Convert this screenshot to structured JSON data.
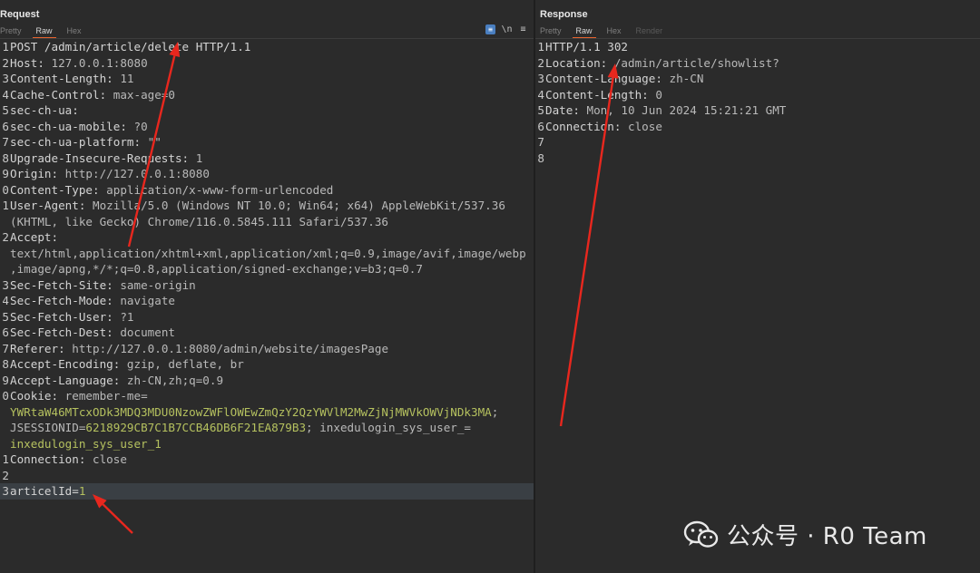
{
  "request": {
    "title": "Request",
    "tabs": [
      "Pretty",
      "Raw",
      "Hex"
    ],
    "active_tab": "Raw",
    "toolbar": {
      "wrap_icon": "wrap-icon",
      "newline_label": "\\n",
      "menu_icon": "menu-icon"
    },
    "lines": [
      {
        "n": "1",
        "parts": [
          {
            "t": "POST /admin/article/delete HTTP/1.1",
            "c": "k"
          }
        ]
      },
      {
        "n": "2",
        "parts": [
          {
            "t": "Host: ",
            "c": "k"
          },
          {
            "t": "127.0.0.1:8080",
            "c": "v"
          }
        ]
      },
      {
        "n": "3",
        "parts": [
          {
            "t": "Content-Length: ",
            "c": "k"
          },
          {
            "t": "11",
            "c": "v"
          }
        ]
      },
      {
        "n": "4",
        "parts": [
          {
            "t": "Cache-Control: ",
            "c": "k"
          },
          {
            "t": "max-age=0",
            "c": "v"
          }
        ]
      },
      {
        "n": "5",
        "parts": [
          {
            "t": "sec-ch-ua:",
            "c": "k"
          }
        ]
      },
      {
        "n": "6",
        "parts": [
          {
            "t": "sec-ch-ua-mobile: ",
            "c": "k"
          },
          {
            "t": "?0",
            "c": "v"
          }
        ]
      },
      {
        "n": "7",
        "parts": [
          {
            "t": "sec-ch-ua-platform: ",
            "c": "k"
          },
          {
            "t": "\"\"",
            "c": "v"
          }
        ]
      },
      {
        "n": "8",
        "parts": [
          {
            "t": "Upgrade-Insecure-Requests: ",
            "c": "k"
          },
          {
            "t": "1",
            "c": "v"
          }
        ]
      },
      {
        "n": "9",
        "parts": [
          {
            "t": "Origin: ",
            "c": "k"
          },
          {
            "t": "http://127.0.0.1:8080",
            "c": "v"
          }
        ]
      },
      {
        "n": "0",
        "parts": [
          {
            "t": "Content-Type: ",
            "c": "k"
          },
          {
            "t": "application/x-www-form-urlencoded",
            "c": "v"
          }
        ]
      },
      {
        "n": "1",
        "parts": [
          {
            "t": "User-Agent: ",
            "c": "k"
          },
          {
            "t": "Mozilla/5.0 (Windows NT 10.0; Win64; x64) AppleWebKit/537.36",
            "c": "v"
          }
        ]
      },
      {
        "n": "",
        "parts": [
          {
            "t": "(KHTML, like Gecko) Chrome/116.0.5845.111 Safari/537.36",
            "c": "v"
          }
        ]
      },
      {
        "n": "2",
        "parts": [
          {
            "t": "Accept:",
            "c": "k"
          }
        ]
      },
      {
        "n": "",
        "parts": [
          {
            "t": "text/html,application/xhtml+xml,application/xml;q=0.9,image/avif,image/webp",
            "c": "v"
          }
        ]
      },
      {
        "n": "",
        "parts": [
          {
            "t": ",image/apng,*/*;q=0.8,application/signed-exchange;v=b3;q=0.7",
            "c": "v"
          }
        ]
      },
      {
        "n": "3",
        "parts": [
          {
            "t": "Sec-Fetch-Site: ",
            "c": "k"
          },
          {
            "t": "same-origin",
            "c": "v"
          }
        ]
      },
      {
        "n": "4",
        "parts": [
          {
            "t": "Sec-Fetch-Mode: ",
            "c": "k"
          },
          {
            "t": "navigate",
            "c": "v"
          }
        ]
      },
      {
        "n": "5",
        "parts": [
          {
            "t": "Sec-Fetch-User: ",
            "c": "k"
          },
          {
            "t": "?1",
            "c": "v"
          }
        ]
      },
      {
        "n": "6",
        "parts": [
          {
            "t": "Sec-Fetch-Dest: ",
            "c": "k"
          },
          {
            "t": "document",
            "c": "v"
          }
        ]
      },
      {
        "n": "7",
        "parts": [
          {
            "t": "Referer: ",
            "c": "k"
          },
          {
            "t": "http://127.0.0.1:8080/admin/website/imagesPage",
            "c": "v"
          }
        ]
      },
      {
        "n": "8",
        "parts": [
          {
            "t": "Accept-Encoding: ",
            "c": "k"
          },
          {
            "t": "gzip, deflate, br",
            "c": "v"
          }
        ]
      },
      {
        "n": "9",
        "parts": [
          {
            "t": "Accept-Language: ",
            "c": "k"
          },
          {
            "t": "zh-CN,zh;q=0.9",
            "c": "v"
          }
        ]
      },
      {
        "n": "0",
        "parts": [
          {
            "t": "Cookie: ",
            "c": "k"
          },
          {
            "t": "remember-me=",
            "c": "v"
          }
        ]
      },
      {
        "n": "",
        "parts": [
          {
            "t": "YWRtaW46MTcxODk3MDQ3MDU0NzowZWFlOWEwZmQzY2QzYWVlM2MwZjNjMWVkOWVjNDk3MA",
            "c": "cv"
          },
          {
            "t": ";",
            "c": "v"
          }
        ]
      },
      {
        "n": "",
        "parts": [
          {
            "t": "JSESSIONID=",
            "c": "v"
          },
          {
            "t": "6218929CB7C1B7CCB46DB6F21EA879B3",
            "c": "cv"
          },
          {
            "t": "; inxedulogin_sys_user_=",
            "c": "v"
          }
        ]
      },
      {
        "n": "",
        "parts": [
          {
            "t": "inxedulogin_sys_user_1",
            "c": "cv"
          }
        ]
      },
      {
        "n": "1",
        "parts": [
          {
            "t": "Connection: ",
            "c": "k"
          },
          {
            "t": "close",
            "c": "v"
          }
        ]
      },
      {
        "n": "2",
        "parts": [
          {
            "t": "",
            "c": "v"
          }
        ]
      },
      {
        "n": "3",
        "hl": true,
        "parts": [
          {
            "t": "articelId=",
            "c": "k"
          },
          {
            "t": "1",
            "c": "pv"
          }
        ]
      }
    ]
  },
  "response": {
    "title": "Response",
    "tabs": [
      "Pretty",
      "Raw",
      "Hex",
      "Render"
    ],
    "active_tab": "Raw",
    "lines": [
      {
        "n": "1",
        "parts": [
          {
            "t": "HTTP/1.1 302",
            "c": "k"
          }
        ]
      },
      {
        "n": "2",
        "parts": [
          {
            "t": "Location: ",
            "c": "k"
          },
          {
            "t": "/admin/article/showlist?",
            "c": "v"
          }
        ]
      },
      {
        "n": "3",
        "parts": [
          {
            "t": "Content-Language: ",
            "c": "k"
          },
          {
            "t": "zh-CN",
            "c": "v"
          }
        ]
      },
      {
        "n": "4",
        "parts": [
          {
            "t": "Content-Length: ",
            "c": "k"
          },
          {
            "t": "0",
            "c": "v"
          }
        ]
      },
      {
        "n": "5",
        "parts": [
          {
            "t": "Date: ",
            "c": "k"
          },
          {
            "t": "Mon, 10 Jun 2024 15:21:21 GMT",
            "c": "v"
          }
        ]
      },
      {
        "n": "6",
        "parts": [
          {
            "t": "Connection: ",
            "c": "k"
          },
          {
            "t": "close",
            "c": "v"
          }
        ]
      },
      {
        "n": "7",
        "parts": [
          {
            "t": "",
            "c": "v"
          }
        ]
      },
      {
        "n": "8",
        "parts": [
          {
            "t": "",
            "c": "v"
          }
        ]
      }
    ]
  },
  "annotation_color": "#e8271e",
  "watermark": {
    "icon": "wechat-icon",
    "text": "公众号 · R0 Team"
  }
}
